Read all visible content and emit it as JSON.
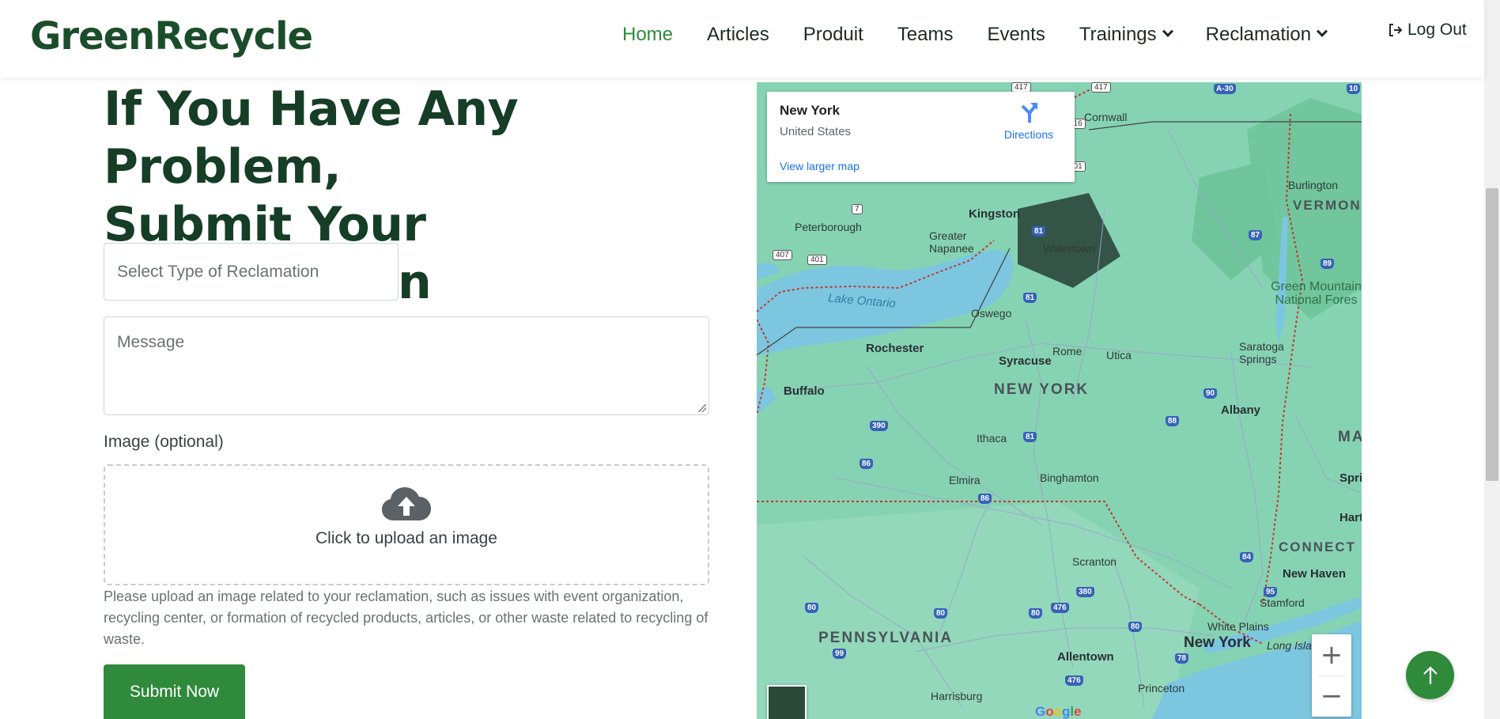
{
  "brand": {
    "name": "GreenRecycle"
  },
  "nav": {
    "items": [
      {
        "label": "Home",
        "active": true
      },
      {
        "label": "Articles"
      },
      {
        "label": "Produit"
      },
      {
        "label": "Teams"
      },
      {
        "label": "Events"
      },
      {
        "label": "Trainings",
        "dropdown": true
      },
      {
        "label": "Reclamation",
        "dropdown": true
      }
    ],
    "logout_label": "Log Out"
  },
  "form": {
    "headline_line1": "If You Have Any Problem,",
    "headline_line2": "Submit Your Reclamation",
    "select_placeholder": "Select Type of Reclamation",
    "message_placeholder": "Message",
    "image_label": "Image (optional)",
    "upload_text": "Click to upload an image",
    "upload_help": "Please upload an image related to your reclamation, such as issues with event organization, recycling center, or formation of recycled products, articles, or other waste related to recycling of waste.",
    "submit_label": "Submit Now"
  },
  "map": {
    "card": {
      "title": "New York",
      "subtitle": "United States",
      "directions_label": "Directions",
      "larger_map_label": "View larger map"
    },
    "labels": {
      "cornwall": "Cornwall",
      "burlington": "Burlington",
      "vermont": "VERMON",
      "kingston": "Kingston",
      "peterborough": "Peterborough",
      "greater_napanee": "Greater Napanee",
      "watertown": "Watertown",
      "lake_ontario": "Lake Ontario",
      "oswego": "Oswego",
      "green_mountain": "Green Mountain National Fores",
      "rochester": "Rochester",
      "rome": "Rome",
      "utica": "Utica",
      "syracuse": "Syracuse",
      "saratoga": "Saratoga Springs",
      "buffalo": "Buffalo",
      "new_york_state": "NEW YORK",
      "albany": "Albany",
      "ma": "MA",
      "ithaca": "Ithaca",
      "elmira": "Elmira",
      "binghamton": "Binghamton",
      "springfield": "Springfi",
      "hartford": "Hartford",
      "connecticut": "CONNECT",
      "scranton": "Scranton",
      "new_haven": "New Haven",
      "stamford": "Stamford",
      "white_plains": "White Plains",
      "new_york_city": "New York",
      "long_island": "Long Isla",
      "pennsylvania": "PENNSYLVANIA",
      "allentown": "Allentown",
      "harrisburg": "Harrisburg",
      "princeton": "Princeton"
    },
    "zoom_in": "+",
    "zoom_out": "−",
    "attribution": "Google"
  },
  "icons": {
    "logout": "sign-out-icon",
    "upload": "cloud-upload-icon",
    "directions": "directions-icon",
    "back_to_top": "arrow-up-icon"
  },
  "colors": {
    "brand_green": "#1b4d2a",
    "accent_green": "#2f8a3b",
    "heading_green": "#163d26",
    "map_land": "#7fd1b0",
    "map_water": "#7cc6e0"
  }
}
